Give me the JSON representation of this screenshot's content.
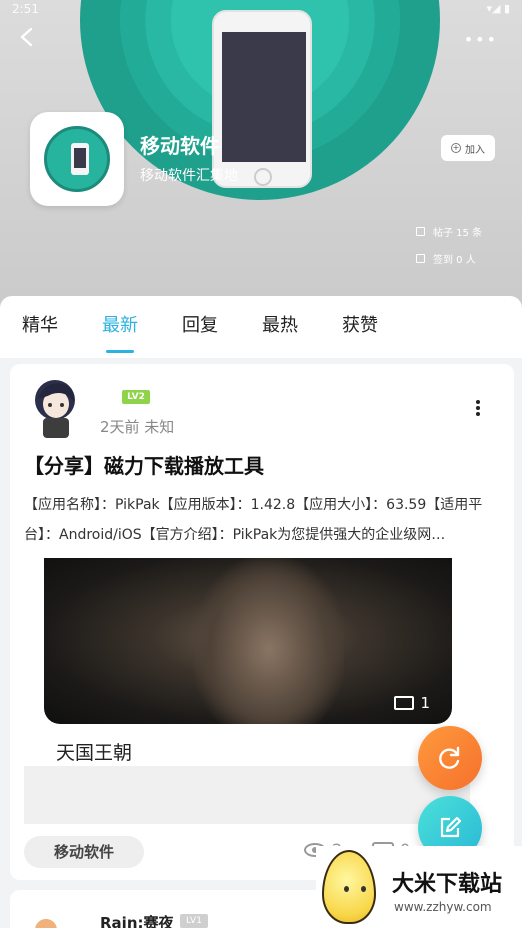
{
  "status_bar": {
    "time": "2:51",
    "right": "▾◢ ▮"
  },
  "header": {
    "forum_name": "移动软件",
    "forum_desc": "移动软件汇集地",
    "join_label": "加入",
    "join_icon": "plus-circle-icon",
    "posts_stat": "帖子 15 条",
    "checkin_stat": "签到 0 人",
    "more_icon": "•••"
  },
  "tabs": [
    {
      "label": "精华",
      "active": false
    },
    {
      "label": "最新",
      "active": true
    },
    {
      "label": "回复",
      "active": false
    },
    {
      "label": "最热",
      "active": false
    },
    {
      "label": "获赞",
      "active": false
    }
  ],
  "post": {
    "level": "LV2",
    "meta": "2天前 未知",
    "title": "【分享】磁力下载播放工具",
    "excerpt": "【应用名称】：PikPak【应用版本】：1.42.8【应用大小】：63.59【适用平台】：Android/iOS【官方介绍】：PikPak为您提供强大的企业级网…",
    "image_count": "1",
    "caption": "天国王朝",
    "tag": "移动软件",
    "views": "2",
    "comments": "0"
  },
  "next_post": {
    "author": "Rain:赛夜",
    "level": "LV1"
  },
  "watermark": {
    "title": "大米下载站",
    "url": "www.zzhyw.com"
  },
  "colors": {
    "accent": "#2bb2e0",
    "teal": "#26b49f",
    "refresh_fab": "#f5702d",
    "edit_fab": "#2ab9d6"
  }
}
